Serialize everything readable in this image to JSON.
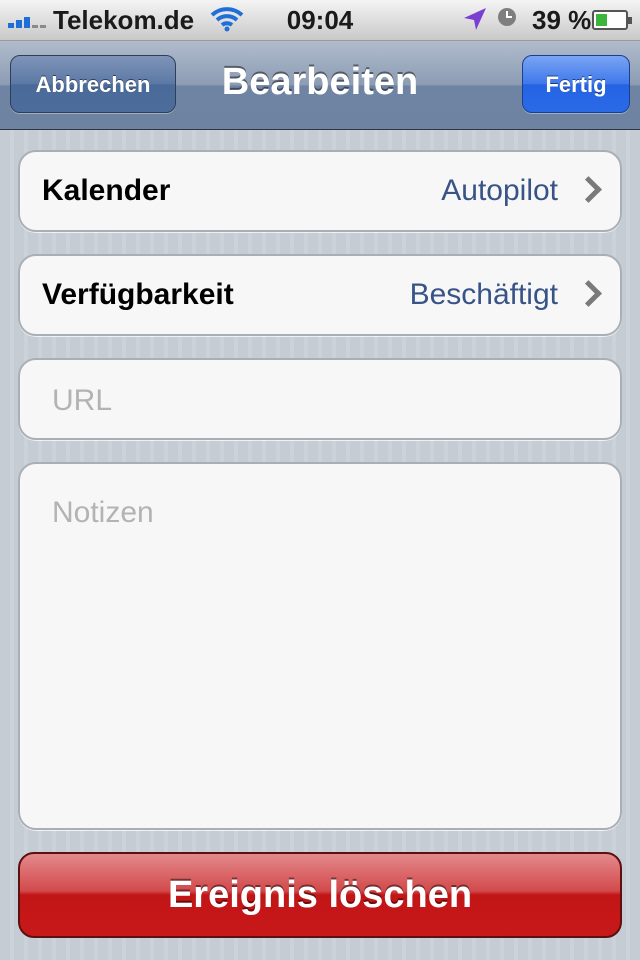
{
  "status_bar": {
    "carrier": "Telekom.de",
    "time": "09:04",
    "battery_percent": "39 %",
    "battery_level": 0.39,
    "icons": [
      "signal-icon",
      "wifi-icon",
      "location-icon",
      "alarm-clock-icon",
      "battery-icon"
    ]
  },
  "nav": {
    "title": "Bearbeiten",
    "cancel_label": "Abbrechen",
    "done_label": "Fertig"
  },
  "rows": [
    {
      "label": "Kalender",
      "value": "Autopilot"
    },
    {
      "label": "Verfügbarkeit",
      "value": "Beschäftigt"
    }
  ],
  "url_field": {
    "placeholder": "URL",
    "value": ""
  },
  "notes_field": {
    "placeholder": "Notizen",
    "value": ""
  },
  "delete_label": "Ereignis löschen",
  "colors": {
    "nav_bar": "#6f84a2",
    "done_button": "#2463e3",
    "delete_button": "#c21516",
    "value_text": "#385487"
  }
}
